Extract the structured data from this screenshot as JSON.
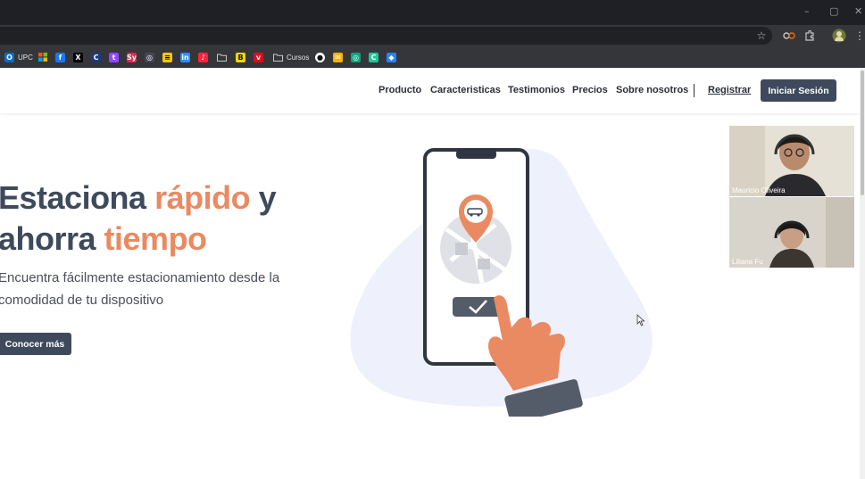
{
  "browser": {
    "window_controls": [
      "–",
      "▢",
      "✕"
    ],
    "toolbar_icons": [
      "star-icon",
      "extension-eye-icon",
      "puzzle-icon",
      "profile-avatar-icon",
      "more-icon"
    ],
    "bookmarks": [
      {
        "icon": "outlook-icon",
        "label": "UPC",
        "color": "#0f6cbd"
      },
      {
        "icon": "microsoft-icon",
        "label": "",
        "color": "#f25022"
      },
      {
        "icon": "facebook-icon",
        "label": "",
        "color": "#1877f2"
      },
      {
        "icon": "x-icon",
        "label": "",
        "color": "#000000"
      },
      {
        "icon": "c-icon",
        "label": "",
        "color": "#1b3a7a"
      },
      {
        "icon": "twitch-icon",
        "label": "",
        "color": "#9146ff"
      },
      {
        "icon": "sy-icon",
        "label": "",
        "color": "#e2264d"
      },
      {
        "icon": "chatgpt-icon",
        "label": "",
        "color": "#444654"
      },
      {
        "icon": "bars-icon",
        "label": "",
        "color": "#f5c518"
      },
      {
        "icon": "linkedin-icon",
        "label": "",
        "color": "#2d8cff"
      },
      {
        "icon": "music-icon",
        "label": "",
        "color": "#fa243c"
      },
      {
        "icon": "folder-icon",
        "label": "",
        "color": "#35363a"
      },
      {
        "icon": "b-icon",
        "label": "",
        "color": "#f2d600"
      },
      {
        "icon": "bird-icon",
        "label": "",
        "color": "#d6101f"
      },
      {
        "icon": "folder-icon",
        "label": "Cursos",
        "color": "#35363a"
      },
      {
        "icon": "github-icon",
        "label": "",
        "color": "#ffffff"
      },
      {
        "icon": "mail-icon",
        "label": "",
        "color": "#f4b400"
      },
      {
        "icon": "chatgpt-icon",
        "label": "",
        "color": "#10a37f"
      },
      {
        "icon": "c-icon",
        "label": "",
        "color": "#20c997"
      },
      {
        "icon": "jira-icon",
        "label": "",
        "color": "#2684ff"
      }
    ]
  },
  "nav": {
    "links": [
      "Producto",
      "Caracteristicas",
      "Testimonios",
      "Precios",
      "Sobre nosotros"
    ],
    "register": "Registrar",
    "login": "Iniciar Sesión"
  },
  "hero": {
    "title_part1": "Estaciona ",
    "title_accent1": "rápido",
    "title_part2": " y",
    "title_part3": "ahorra ",
    "title_accent2": "tiempo",
    "subtitle": "Encuentra fácilmente estacionamiento desde la comodidad de tu dispositivo",
    "cta": "Conocer más"
  },
  "participants": [
    {
      "name": "Mauricio Oliveira"
    },
    {
      "name": "Liliana Fu"
    }
  ],
  "colors": {
    "primary": "#3e4a5c",
    "accent": "#ea8a62",
    "blob": "#eef1fb"
  }
}
